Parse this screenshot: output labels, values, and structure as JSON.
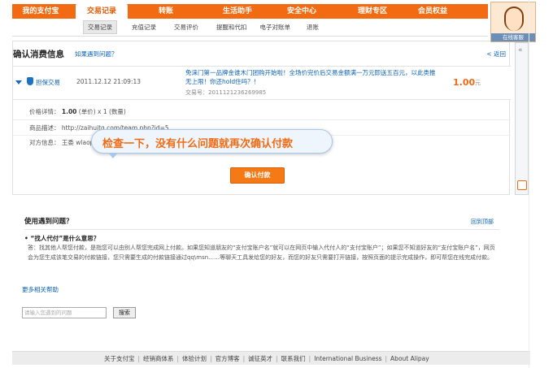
{
  "topnav": {
    "items": [
      {
        "label": "我的支付宝"
      },
      {
        "label": "交易记录"
      },
      {
        "label": "转账"
      },
      {
        "label": "生活助手"
      },
      {
        "label": "安全中心"
      },
      {
        "label": "理财专区"
      },
      {
        "label": "会员权益"
      }
    ],
    "active_index": 1
  },
  "subnav": {
    "items": [
      {
        "label": "交易记录"
      },
      {
        "label": "充值记录"
      },
      {
        "label": "交易评价"
      },
      {
        "label": "提醒和代扣"
      },
      {
        "label": "电子对账单"
      },
      {
        "label": "退账"
      }
    ]
  },
  "page": {
    "title": "确认消费信息",
    "help_link": "如果遇到问题？",
    "back_link": "< 返回"
  },
  "trade": {
    "type": "担保交易",
    "time": "2011.12.12 21:09:13",
    "title": "免涞门第一品牌金谁木门团购开始啦！全场价完价后交易金额满一万元即送五百元，以此类推无上限！你还hold住吗？！",
    "trade_no": "交易号：2011121236269985",
    "amount": "1.00",
    "unit": "元"
  },
  "details": {
    "price_label": "价格详情：",
    "price_value": "1.00",
    "price_suffix": "(单价) x 1 (数量)",
    "desc_label": "商品描述：",
    "desc_value": "http://zaihuitg.com/team.php?id=5",
    "party_label": "对方信息：",
    "party_value": "王委  wlaop"
  },
  "tooltip": {
    "text": "检查一下，没有什么问题就再次确认付款"
  },
  "confirm_button": "确认付款",
  "right_widget": {
    "label": "在线客服"
  },
  "help": {
    "title": "使用遇到问题？",
    "back_top": "回到顶部",
    "question": "“找人代付”是什么意思？",
    "answer": "答：找其他人帮您付款，是指您可以由别人帮您完成网上付款。如果您知道朋友的“支付宝账户名”就可以在网页中输入代付人的“支付宝账户”；如果您不知道好友的“支付宝账户名”，网页会为您生成该笔交易的付款链接，您只需要生成的付款链接通过qq\\msn……等聊天工具发给您的好友，而您的好友只需要打开链接，按照页面的提示完成操作，即可帮您在线完成付款。",
    "more": "更多相关帮助",
    "search_placeholder": "请输入您遇到的问题",
    "search_button": "搜索"
  },
  "footer": {
    "links": [
      "关于支付宝",
      "经销商体系",
      "体验计划",
      "官方博客",
      "诚征英才",
      "联系我们",
      "International Business",
      "About Alipay"
    ]
  },
  "colors": {
    "accent": "#f26b12",
    "link": "#0a62b6"
  }
}
